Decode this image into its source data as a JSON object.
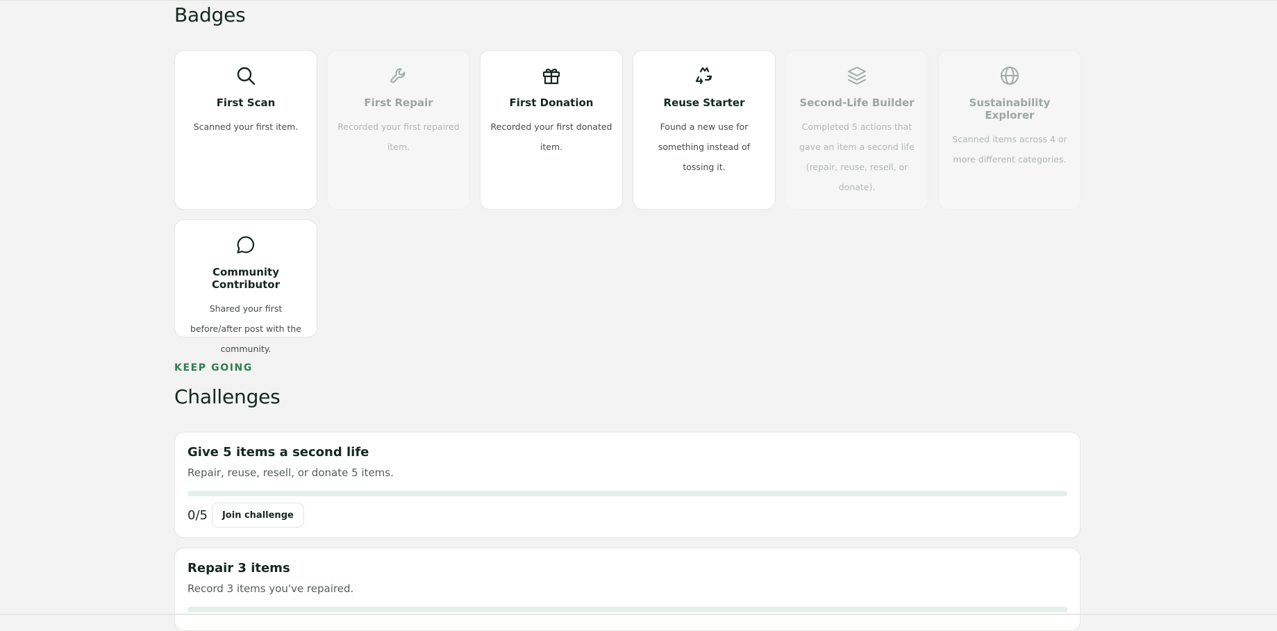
{
  "badges": {
    "title": "Badges",
    "items": [
      {
        "name": "First Scan",
        "description": "Scanned your first item.",
        "icon": "search-icon",
        "locked": false
      },
      {
        "name": "First Repair",
        "description": "Recorded your first repaired item.",
        "icon": "wrench-icon",
        "locked": true
      },
      {
        "name": "First Donation",
        "description": "Recorded your first donated item.",
        "icon": "gift-icon",
        "locked": false
      },
      {
        "name": "Reuse Starter",
        "description": "Found a new use for something instead of tossing it.",
        "icon": "reuse-icon",
        "locked": false
      },
      {
        "name": "Second-Life Builder",
        "description": "Completed 5 actions that gave an item a second life (repair, reuse, resell, or donate).",
        "icon": "layers-icon",
        "locked": true
      },
      {
        "name": "Sustainability Explorer",
        "description": "Scanned items across 4 or more different categories.",
        "icon": "globe-icon",
        "locked": true
      },
      {
        "name": "Community Contributor",
        "description": "Shared your first before/after post with the community.",
        "icon": "chat-bubble-icon",
        "locked": false
      }
    ]
  },
  "challenges": {
    "eyebrow": "KEEP GOING",
    "title": "Challenges",
    "items": [
      {
        "name": "Give 5 items a second life",
        "description": "Repair, reuse, resell, or donate 5 items.",
        "progress": 0,
        "goal": 5,
        "progress_label": "0/5",
        "button_label": "Join challenge"
      },
      {
        "name": "Repair 3 items",
        "description": "Record 3 items you've repaired.",
        "progress": 0,
        "goal": 3
      }
    ]
  },
  "colors": {
    "accent": "#2e7d4f",
    "background": "#f2f3f2",
    "card": "#ffffff",
    "text": "#15271f"
  }
}
